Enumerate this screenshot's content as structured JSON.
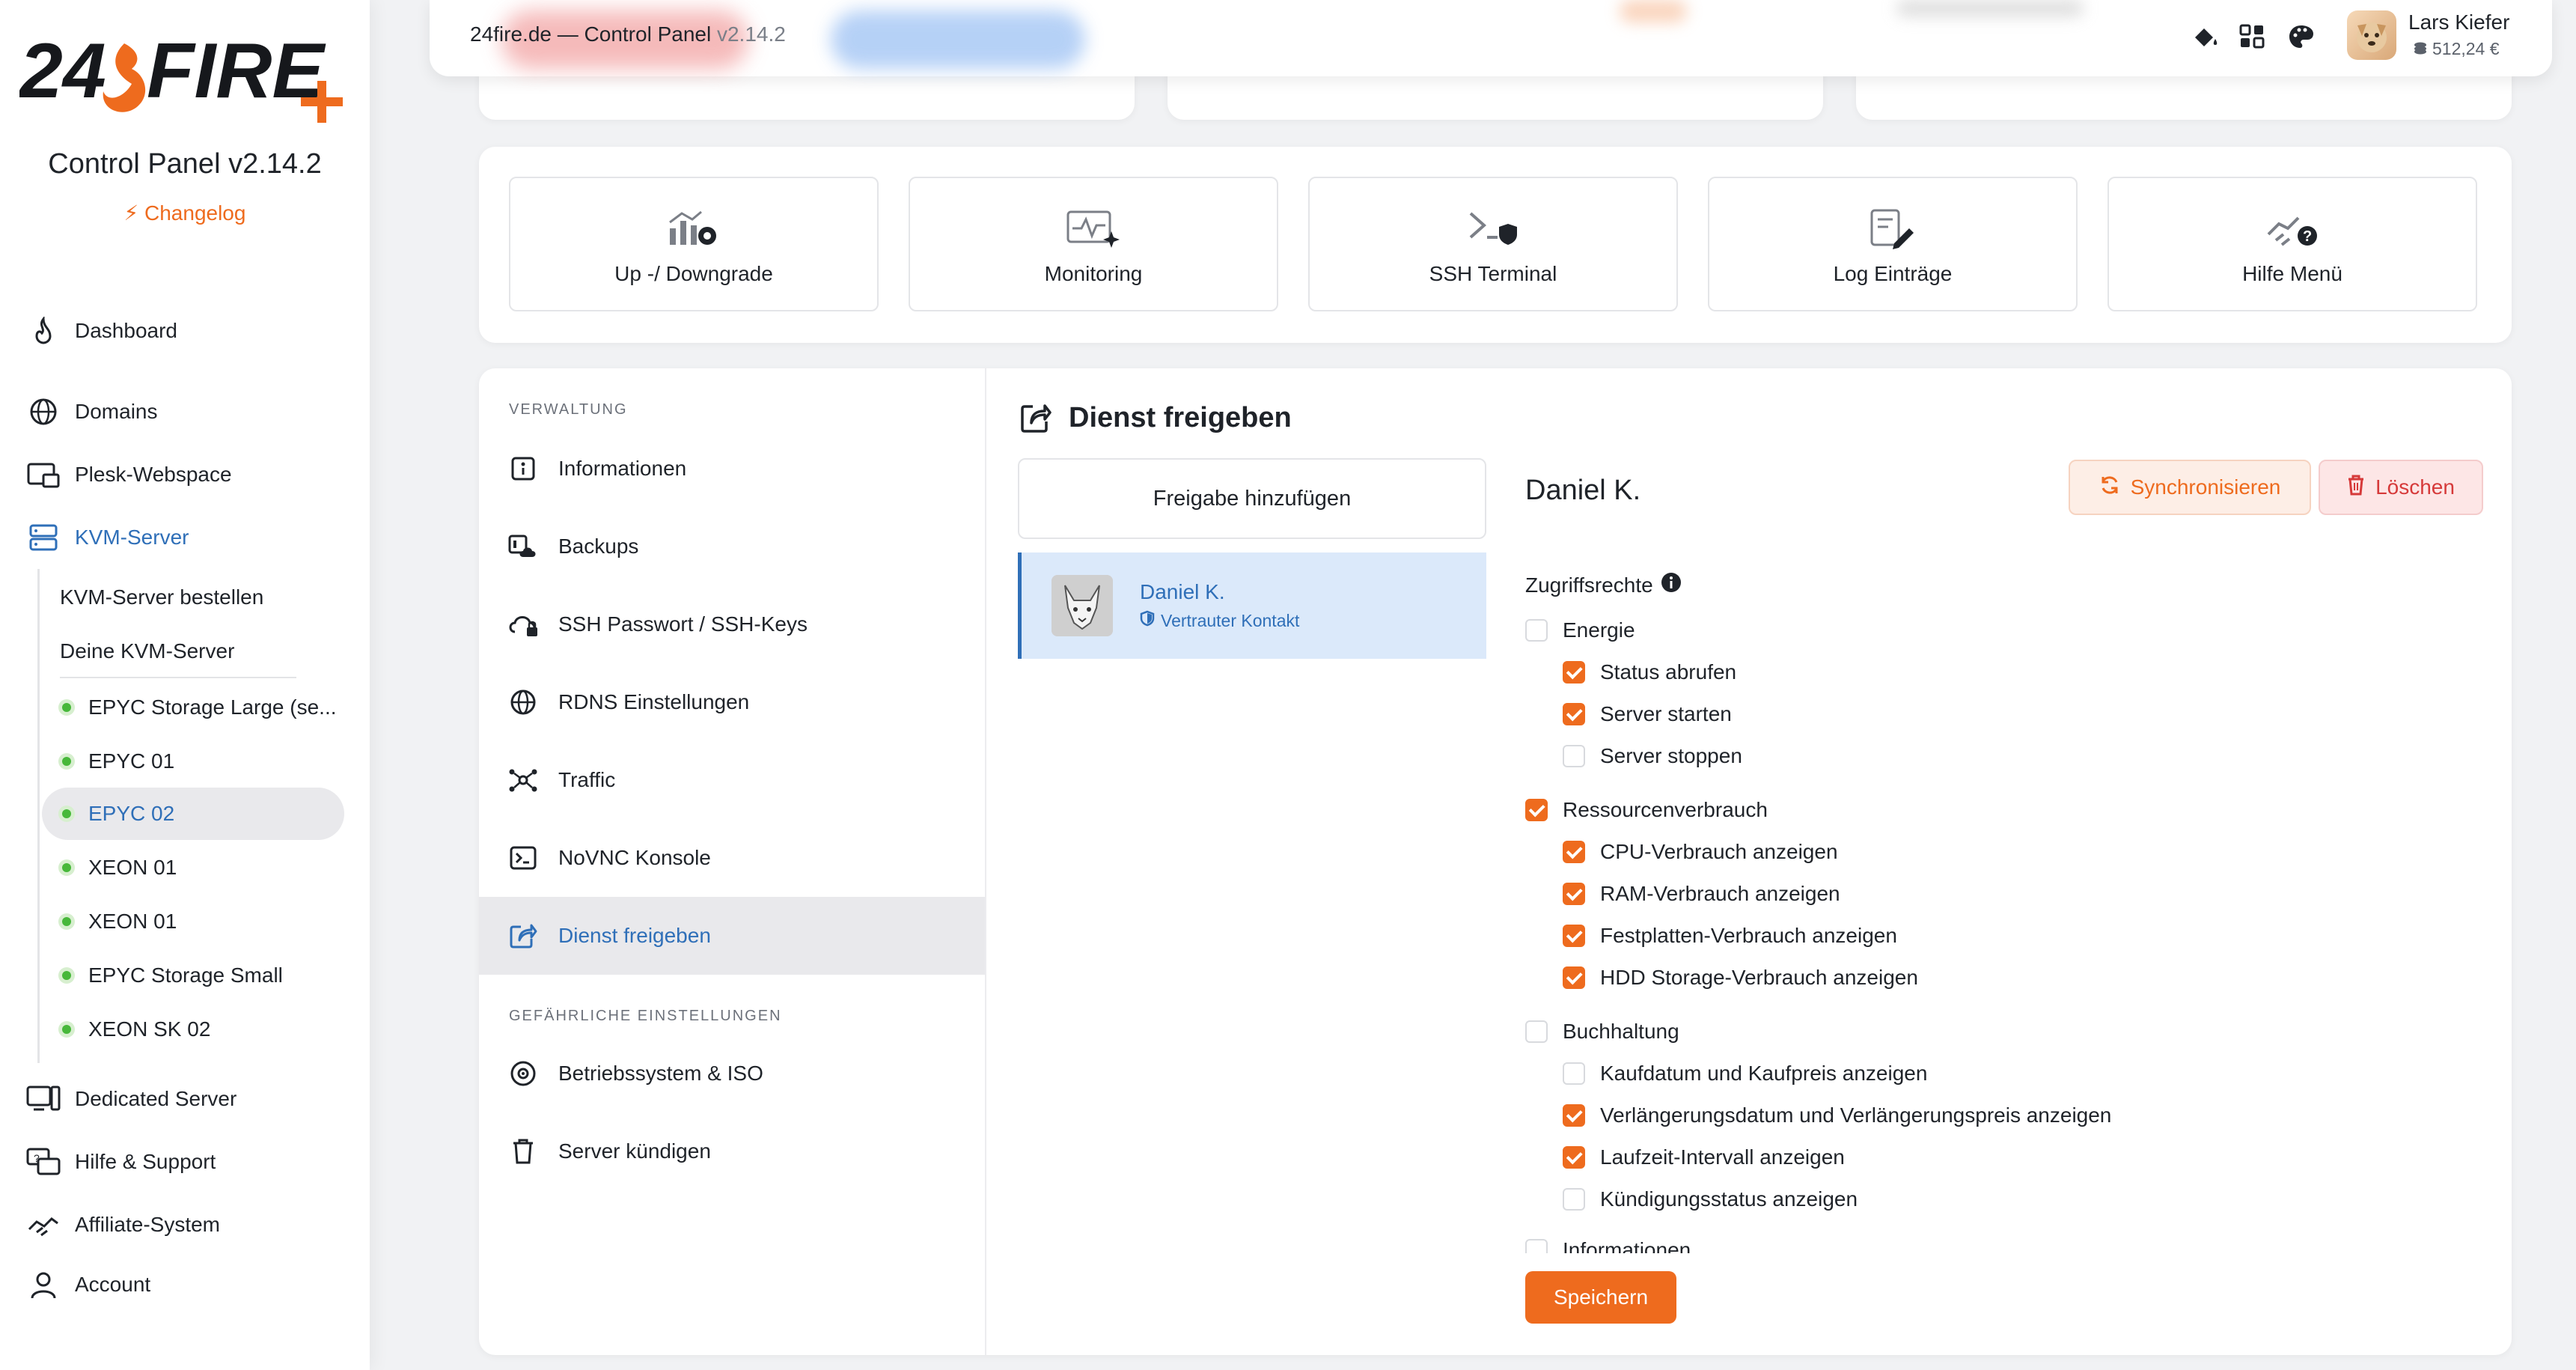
{
  "brand": {
    "logo_text": "24FIRE",
    "panel_title": "Control Panel v2.14.2",
    "changelog": "Changelog",
    "accent": "#ee6b1e"
  },
  "sidebar": {
    "dashboard": "Dashboard",
    "domains": "Domains",
    "plesk": "Plesk-Webspace",
    "kvm": "KVM-Server",
    "kvm_order": "KVM-Server bestellen",
    "kvm_yours": "Deine KVM-Server",
    "servers": [
      "EPYC Storage Large (se...",
      "EPYC 01",
      "EPYC 02",
      "XEON 01",
      "XEON 01",
      "EPYC Storage Small",
      "XEON SK 02"
    ],
    "dedicated": "Dedicated Server",
    "support": "Hilfe & Support",
    "affiliate": "Affiliate-System",
    "account": "Account"
  },
  "topbar": {
    "title": "24fire.de — Control Panel",
    "version": "v2.14.2",
    "user_name": "Lars Kiefer",
    "user_credit": "512,24 €"
  },
  "quick_actions": [
    "Up -/ Downgrade",
    "Monitoring",
    "SSH Terminal",
    "Log Einträge",
    "Hilfe Menü"
  ],
  "submenu": {
    "heading_admin": "VERWALTUNG",
    "items": [
      "Informationen",
      "Backups",
      "SSH Passwort / SSH-Keys",
      "RDNS Einstellungen",
      "Traffic",
      "NoVNC Konsole",
      "Dienst freigeben"
    ],
    "heading_danger": "GEFÄHRLICHE EINSTELLUNGEN",
    "danger_items": [
      "Betriebssystem & ISO",
      "Server kündigen"
    ]
  },
  "share": {
    "title": "Dienst freigeben",
    "add_button": "Freigabe hinzufügen",
    "contact_name": "Daniel K.",
    "contact_badge": "Vertrauter Kontakt",
    "detail_name": "Daniel K.",
    "sync_button": "Synchronisieren",
    "delete_button": "Löschen",
    "permissions_label": "Zugriffsrechte",
    "save_button": "Speichern",
    "permissions": [
      {
        "label": "Energie",
        "checked": false
      },
      {
        "label": "Status abrufen",
        "checked": true
      },
      {
        "label": "Server starten",
        "checked": true
      },
      {
        "label": "Server stoppen",
        "checked": false
      },
      {
        "label": "Ressourcenverbrauch",
        "checked": true
      },
      {
        "label": "CPU-Verbrauch anzeigen",
        "checked": true
      },
      {
        "label": "RAM-Verbrauch anzeigen",
        "checked": true
      },
      {
        "label": "Festplatten-Verbrauch anzeigen",
        "checked": true
      },
      {
        "label": "HDD Storage-Verbrauch anzeigen",
        "checked": true
      },
      {
        "label": "Buchhaltung",
        "checked": false
      },
      {
        "label": "Kaufdatum und Kaufpreis anzeigen",
        "checked": false
      },
      {
        "label": "Verlängerungsdatum und Verlängerungspreis anzeigen",
        "checked": true
      },
      {
        "label": "Laufzeit-Intervall anzeigen",
        "checked": true
      },
      {
        "label": "Kündigungsstatus anzeigen",
        "checked": false
      },
      {
        "label": "Informationen",
        "checked": false
      }
    ]
  }
}
